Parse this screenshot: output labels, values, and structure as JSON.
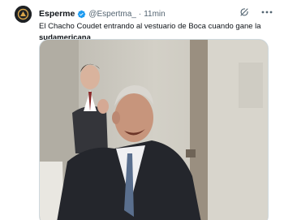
{
  "tweet": {
    "author_name": "Esperme",
    "handle": "@Espertma_",
    "separator": "·",
    "time": "11min",
    "text_line1": "El Chacho Coudet entrando al vestuario de Boca cuando gane la",
    "text_line2_bold": "sudamericana"
  },
  "icons": {
    "verified": "verified-badge-icon",
    "grok": "grok-icon",
    "more": "more-icon"
  },
  "colors": {
    "verified_blue": "#1d9bf0",
    "text_primary": "#0f1419",
    "text_secondary": "#536471"
  }
}
